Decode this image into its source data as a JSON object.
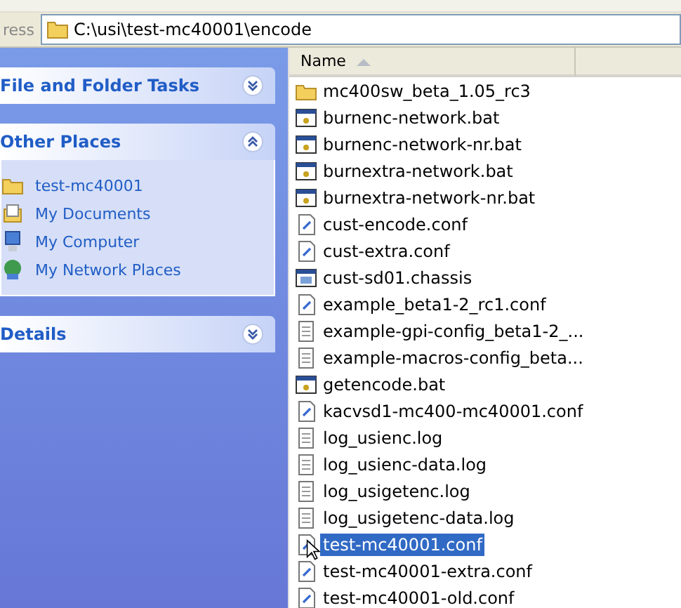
{
  "address_bar": {
    "label": "ress",
    "path": "C:\\usi\\test-mc40001\\encode"
  },
  "tasks": [
    {
      "title": "File and Folder Tasks",
      "expanded": false
    },
    {
      "title": "Other Places",
      "expanded": true,
      "items": [
        {
          "label": "test-mc40001",
          "kind": "folder"
        },
        {
          "label": "My Documents",
          "kind": "documents"
        },
        {
          "label": "My Computer",
          "kind": "computer"
        },
        {
          "label": "My Network Places",
          "kind": "network"
        }
      ]
    },
    {
      "title": "Details",
      "expanded": false
    }
  ],
  "columns": [
    {
      "label": "Name",
      "sorted": true
    }
  ],
  "files": [
    {
      "name": "mc400sw_beta_1.05_rc3",
      "kind": "folder",
      "selected": false
    },
    {
      "name": "burnenc-network.bat",
      "kind": "bat",
      "selected": false
    },
    {
      "name": "burnenc-network-nr.bat",
      "kind": "bat",
      "selected": false
    },
    {
      "name": "burnextra-network.bat",
      "kind": "bat",
      "selected": false
    },
    {
      "name": "burnextra-network-nr.bat",
      "kind": "bat",
      "selected": false
    },
    {
      "name": "cust-encode.conf",
      "kind": "conf",
      "selected": false
    },
    {
      "name": "cust-extra.conf",
      "kind": "conf",
      "selected": false
    },
    {
      "name": "cust-sd01.chassis",
      "kind": "chassis",
      "selected": false
    },
    {
      "name": "example_beta1-2_rc1.conf",
      "kind": "conf",
      "selected": false
    },
    {
      "name": "example-gpi-config_beta1-2_...",
      "kind": "text",
      "selected": false
    },
    {
      "name": "example-macros-config_beta...",
      "kind": "text",
      "selected": false
    },
    {
      "name": "getencode.bat",
      "kind": "bat",
      "selected": false
    },
    {
      "name": "kacvsd1-mc400-mc40001.conf",
      "kind": "conf",
      "selected": false
    },
    {
      "name": "log_usienc.log",
      "kind": "text",
      "selected": false
    },
    {
      "name": "log_usienc-data.log",
      "kind": "text",
      "selected": false
    },
    {
      "name": "log_usigetenc.log",
      "kind": "text",
      "selected": false
    },
    {
      "name": "log_usigetenc-data.log",
      "kind": "text",
      "selected": false
    },
    {
      "name": "test-mc40001.conf",
      "kind": "conf",
      "selected": true
    },
    {
      "name": "test-mc40001-extra.conf",
      "kind": "conf",
      "selected": false
    },
    {
      "name": "test-mc40001-old.conf",
      "kind": "conf",
      "selected": false
    }
  ]
}
